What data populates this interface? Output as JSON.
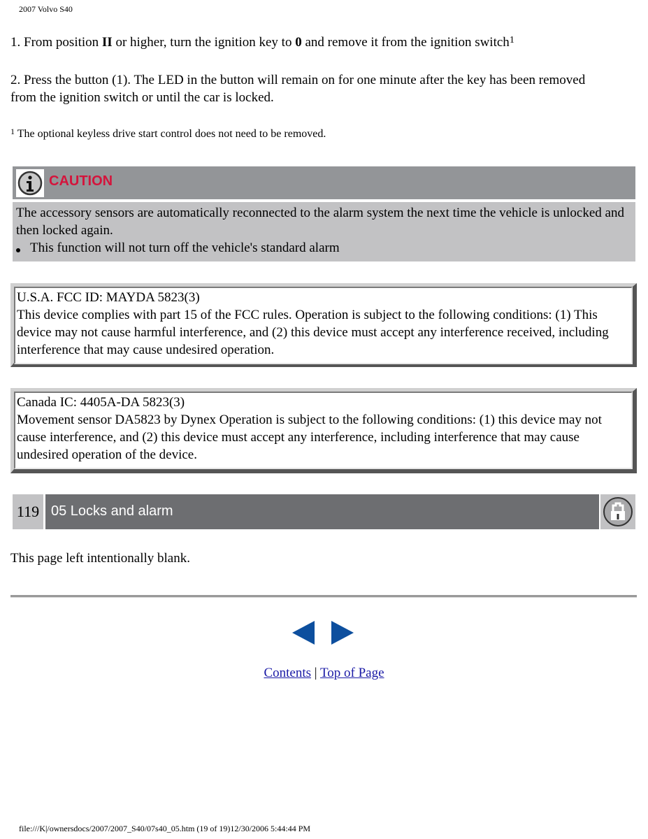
{
  "header": {
    "title": "2007 Volvo S40"
  },
  "steps": {
    "step1": {
      "prefix": "1. From position ",
      "bold1": "II",
      "middle": " or higher, turn the ignition key to ",
      "bold2": "0",
      "suffix": " and remove it from the ignition switch",
      "footnote_ref": "1"
    },
    "step2": "2. Press the button (1). The LED in the button will remain on for one minute after the key has been removed from the ignition switch or until the car is locked."
  },
  "footnote": {
    "marker": "1",
    "text": " The optional keyless drive start control does not need to be removed."
  },
  "caution": {
    "icon": "info-icon",
    "label": "CAUTION",
    "label_color": "#d4143c",
    "text": "The accessory sensors are automatically reconnected to the alarm system the next time the vehicle is unlocked and then locked again.",
    "bullets": [
      "This function will not turn off the vehicle's standard alarm"
    ]
  },
  "fcc_box": {
    "line1": "U.S.A. FCC ID: MAYDA 5823(3)",
    "body": "This device complies with part 15 of the FCC rules. Operation is subject to the following conditions: (1) This device may not cause harmful interference, and (2) this device must accept any interference received, including interference that may cause undesired operation."
  },
  "canada_box": {
    "line1": "Canada IC: 4405A-DA 5823(3)",
    "body": "Movement sensor DA5823 by Dynex Operation is subject to the following conditions: (1) this device may not cause interference, and (2) this device must accept any interference, including interference that may cause undesired operation of the device."
  },
  "section": {
    "page_number": "119",
    "title": "05 Locks and alarm",
    "icon": "padlock-icon"
  },
  "blank_page_text": "This page left intentionally blank.",
  "navigation": {
    "prev_icon": "arrow-left-icon",
    "next_icon": "arrow-right-icon",
    "arrow_color": "#0d4f9e",
    "contents_link": "Contents",
    "separator": "|",
    "top_link": "Top of Page"
  },
  "footer": {
    "url": "file:///K|/ownersdocs/2007/2007_S40/07s40_05.htm (19 of 19)12/30/2006 5:44:44 PM"
  }
}
